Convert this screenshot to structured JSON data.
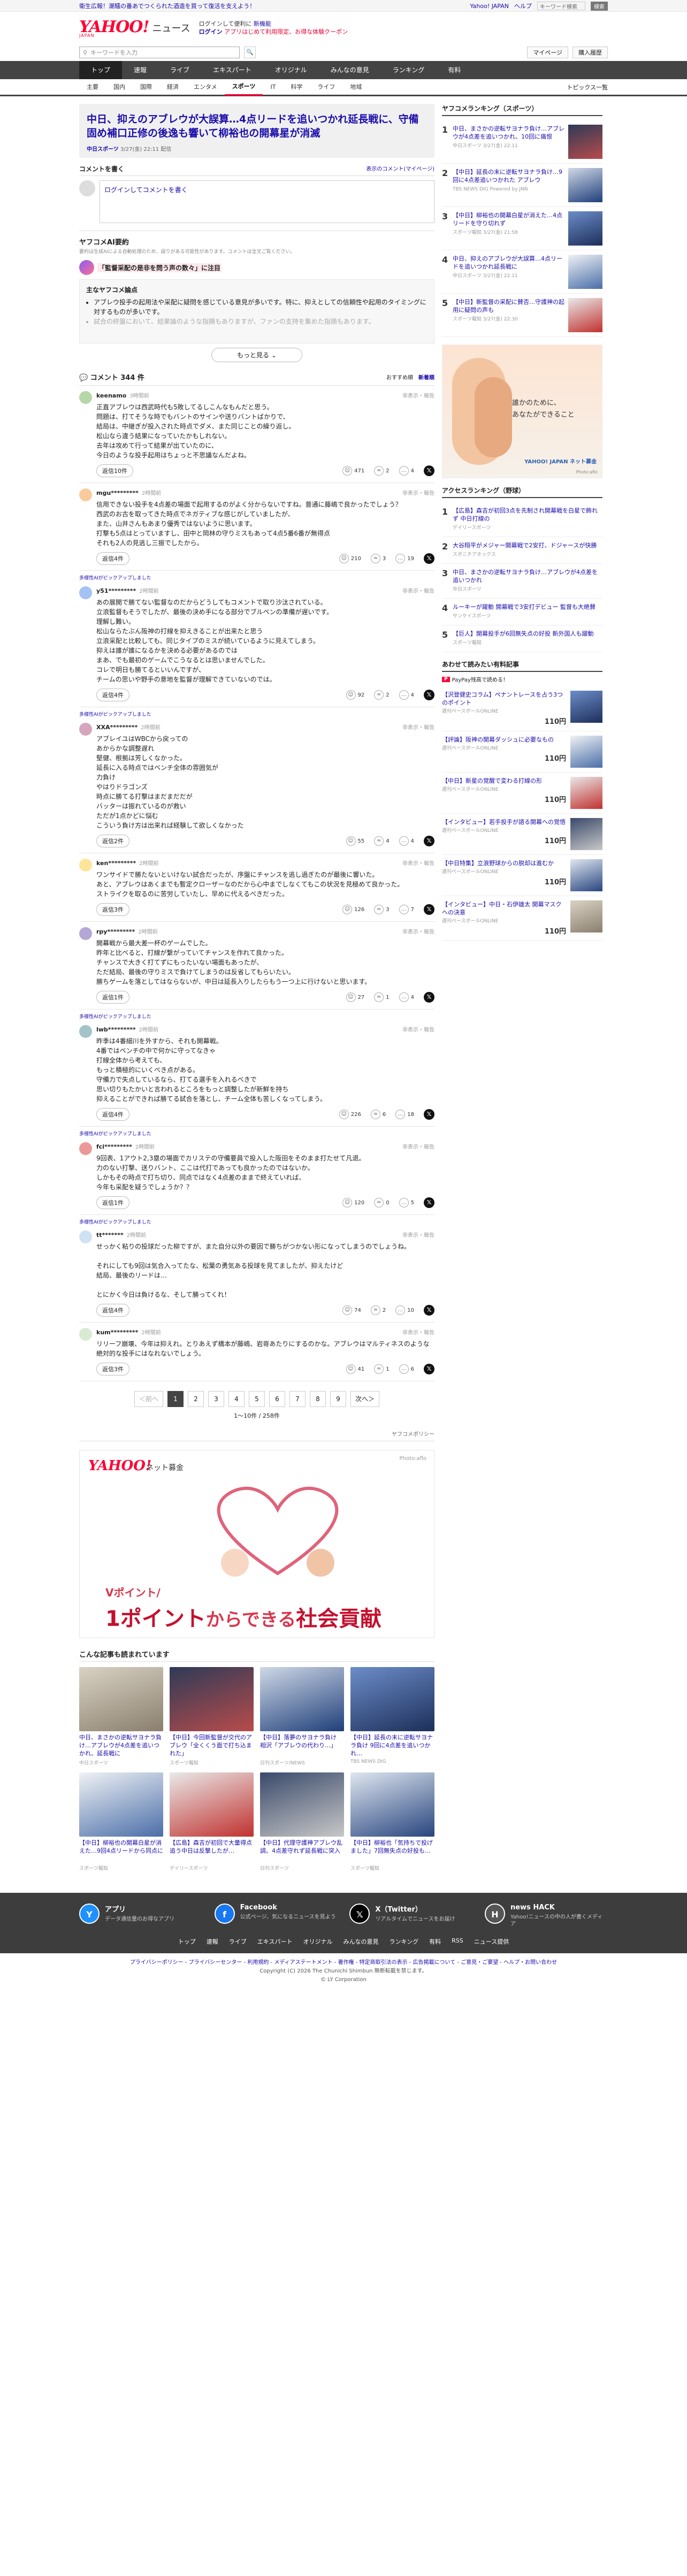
{
  "promo": {
    "text": "衛生広報！潮騒の番あでつくられた酒造を買って復活を支えよう！",
    "links": [
      "Yahoo! JAPAN",
      "ヘルプ"
    ],
    "search_placeholder": "キーワード検索",
    "search_button": "検索"
  },
  "header": {
    "logo": "YAHOO!",
    "logo_sub": "JAPAN",
    "logo_news": "ニュース",
    "line1": "ログインして便利に",
    "line1_link": "新機能",
    "login": "ログイン",
    "line2": "アプリはじめて利用限定、お得な体験クーポン"
  },
  "search": {
    "placeholder": "キーワードを入力",
    "my_page": "マイページ",
    "register": "購入履歴"
  },
  "nav": {
    "main": [
      "トップ",
      "速報",
      "ライブ",
      "エキスパート",
      "オリジナル",
      "みんなの意見",
      "ランキング",
      "有料"
    ],
    "sub": [
      "主要",
      "国内",
      "国際",
      "経済",
      "エンタメ",
      "スポーツ",
      "IT",
      "科学",
      "ライフ",
      "地域"
    ],
    "topics": "トピックス一覧"
  },
  "article": {
    "title": "中日、抑えのアブレウが大誤算…4点リードを追いつかれ延長戦に、守備固め補口正修の後逸も響いて柳裕也の開幕星が消滅",
    "source": "中日スポーツ",
    "date": "3/27(金) 22:11 配信"
  },
  "comment_input": {
    "heading": "コメントを書く",
    "policy_link": "表示のコメント(マイページ)",
    "placeholder": "ログインしてコメントを書く"
  },
  "ai": {
    "title": "ヤフコメAI要約",
    "note": "要約は生成AIによる自動処理のため、誤りがある可能性があります。コメントは全文ご覧ください。",
    "point_prefix": "「監督采配の是非を問う声の数々」に注目",
    "box_label": "主なヤフコメ論点",
    "bullets": [
      "アブレウ投手の起用法や采配に疑問を感じている意見が多いです。特に、抑えとしての信頼性や起用のタイミングに対するものが多いです。",
      "試合の終盤において、結果論のような指摘もありますが、ファンの支持を集めた指摘もあります。"
    ],
    "more": "もっと見る"
  },
  "comments_header": {
    "count": "コメント 344 件",
    "sort": [
      "おすすめ順",
      "新着順"
    ]
  },
  "comments": [
    {
      "user": "keenamo",
      "time": "3時間前",
      "report": "非表示・報告",
      "text": "正直アブレウは西武時代も5敗してるしこんなもんだと思う。\n問題は、打てそうな時でもバントのサインや送りバントばかりで、\n結局は、中継ぎが投入された時点でダメ、また同じことの繰り返し。\n松山なら違う結果になっていたかもしれない。\n去年は攻めて行って結果が出ていたのに、\n今日のような投手起用はちょっと不思議なんだよね。",
      "replies": "返信10件",
      "likes": "471",
      "ok": "2",
      "hmm": "4"
    },
    {
      "user": "mgu*********",
      "time": "2時間前",
      "report": "非表示・報告",
      "text": "信用できない投手を4点差の場面で起用するのがよく分からないですね。普通に藤嶋で良かったでしょう？\n西武のお古を取ってきた時点でネガティブな感じがしていましたが、\nまた、山井さんもあまり優秀ではないように思います。\n打撃も5点はとっていますし、田中と岡林の守りミスもあって4点5番6番が無得点\nそれも2人の見逃し三振でしたから。",
      "replies": "返信4件",
      "likes": "210",
      "ok": "3",
      "hmm": "19"
    },
    {
      "user": "y51*********",
      "time": "2時間前",
      "report": "非表示・報告",
      "text": "あの展開で勝てない監督なのだからどうしてもコメントで取り沙汰されている。\n立浪監督もそうでしたが、最後の決め手になる部分でブルペンの準備が遅いです。\n理解し難い。\n松山ならたぶん阪神の打線を抑えきることが出来たと思う\n立浪采配と比較しても、同じタイプのミスが続いているように見えてしまう。\n抑えは誰が誰になるかを決める必要があるのでは\nまあ、でも最初のゲームでこうなるとは思いませんでした。\nコレで明日も勝てるといいんですが、\nチームの思いや野手の意地を監督が理解できていないのでは。",
      "replies": "返信4件",
      "likes": "92",
      "ok": "2",
      "hmm": "4"
    },
    {
      "user": "XXA*********",
      "time": "2時間前",
      "report": "非表示・報告",
      "text": "アブレイユはWBCから戻っての\nあからかな調整遅れ\n堅健、根拠は芳しくなかった。\n延長に入る時点ではベンチ全体の雰囲気が\n力負け\nやはりドラゴンズ\n時点に勝てる打撃はまだまだだが\nバッターは振れているのが救い\nただが1点かどに悩む\nこういう負け方は出来れば経験して欲しくなかった",
      "replies": "返信2件",
      "likes": "55",
      "ok": "4",
      "hmm": "4"
    },
    {
      "user": "ken*********",
      "time": "2時間前",
      "report": "非表示・報告",
      "text": "ワンサイドで勝たないといけない試合だったが、序盤にチャンスを逃し過ぎたのが最後に響いた。\nあと、アブレウはあくまでも暫定クローザーなのだから心中までしなくてもこの状況を見極めて良かった。\nストライクを取るのに苦労していたし、早めに代えるべきだった。",
      "replies": "返信3件",
      "likes": "126",
      "ok": "3",
      "hmm": "7"
    },
    {
      "user": "rpy*********",
      "time": "2時間前",
      "report": "非表示・報告",
      "text": "開幕戦から最大差一杯のゲームでした。\n昨年と比べると、打線が繋がっていてチャンスを作れて良かった。\nチャンスで大きく打てずにもったいない場面もあったが、\nただ結局、最後の守りミスで負けてしまうのは反省してもらいたい。\n勝ちゲームを落としてはならないが、中日は延長入りしたらもう一つ上に行けないと思います。",
      "replies": "返信1件",
      "likes": "27",
      "ok": "1",
      "hmm": "4"
    },
    {
      "user": "lwb*********",
      "time": "2時間前",
      "report": "非表示・報告",
      "text": "昨季は4番細川を外すから、それも開幕戦。\n4番ではベンチの中で何かに守ってなきゃ\n打線全体から考えても、\nもっと積極的にいくべき点がある。\n守備力で失点しているなら、打てる選手を入れるべきで\n思い切りもたかいと言われるところをもっと調整したが新鮮を持ち\n抑えることができれば勝てる試合を落とし、チーム全体も苦しくなってしまう。",
      "replies": "返信4件",
      "likes": "226",
      "ok": "6",
      "hmm": "18"
    },
    {
      "user": "fci*********",
      "time": "2時間前",
      "report": "非表示・報告",
      "text": "9回表、1アウト2,3塁の場面でカリステの守備要員で投入した阪田をそのまま打たせて凡退。\n力のない打撃、送りバント、ここは代打であっても良かったのではないか。\nしかもその時点で打ち切り、同点ではなく4点差のままで終えていれば、\n今年も采配を疑うでしょうか？？",
      "replies": "返信1件",
      "likes": "120",
      "ok": "0",
      "hmm": "5"
    },
    {
      "user": "tt*******",
      "time": "2時間前",
      "report": "非表示・報告",
      "text": "せっかく粘りの投球だった柳ですが、また自分以外の要因で勝ちがつかない形になってしまうのでしょうね。\n\nそれにしても9回は気合入ってたな、松葉の勇気ある投球を見てましたが、抑えたけど\n結局、最後のリードは…\n\nとにかく今日は負けるな、そして勝ってくれ！",
      "replies": "返信4件",
      "likes": "74",
      "ok": "2",
      "hmm": "10"
    },
    {
      "user": "kum*********",
      "time": "2時間前",
      "report": "非表示・報告",
      "text": "リリーフ崩壊、今年は抑えれ。とりあえず橋本が藤嶋、岩嵜あたりにするのかな。アブレウはマルティネスのような\n絶対的な投手にはなれないでしょう。",
      "replies": "返信3件",
      "likes": "41",
      "ok": "1",
      "hmm": "6"
    }
  ],
  "ad_labels": [
    "多様性AIがピックアップしました"
  ],
  "pager": {
    "prev": "＜前へ",
    "pages": [
      "1",
      "2",
      "3",
      "4",
      "5",
      "6",
      "7",
      "8",
      "9"
    ],
    "next": "次へ＞",
    "count": "1〜10件 / 258件",
    "policy": "ヤフコメポリシー"
  },
  "bigad": {
    "logo": "YAHOO!",
    "fund": "ネット募金",
    "photo": "Photo:aflo",
    "v1": "Vポイント/",
    "v2_a": "1ポイント",
    "v2_b": "からできる",
    "v2_c": "社会貢献"
  },
  "recommend": {
    "title": "こんな記事も読まれています",
    "items": [
      {
        "text": "中日、まさかの逆転サヨナラ負け…アブレウが4点差を追いつかれ、延長戦に",
        "src": "中日スポーツ"
      },
      {
        "text": "【中日】今回新監督が交代のアブレウ「全くくう面で打ち込まれた」",
        "src": "スポーツ報知"
      },
      {
        "text": "【中日】落夢のサヨナラ負け 相沢「アブレウの代わり…」",
        "src": "日刊スポーツ/NEWS"
      },
      {
        "text": "【中日】延長の末に逆転サヨナラ負け 9回に4点差を追いつかれ…",
        "src": "TBS NEWS DIG"
      },
      {
        "text": "【中日】柳裕也の開幕白星が消えた…9回4点リードから同点に",
        "src": "スポーツ報知"
      },
      {
        "text": "【広島】森吉が初回で大量得点 追う中日は反撃したが…",
        "src": "デイリースポーツ"
      },
      {
        "text": "【中日】代理守護神アブレウ乱調、4点差守れず延長戦に突入",
        "src": "日刊スポーツ"
      },
      {
        "text": "【中日】柳裕也「気持ちで投げました」7回無失点の好投も…",
        "src": "スポーツ報知"
      }
    ]
  },
  "side": {
    "ranking_title": "ヤフコメランキング（スポーツ）",
    "ranking": [
      {
        "text": "中日、まさかの逆転サヨナラ負け…アブレウが4点差を追いつかれ、10回に痛恨",
        "src": "中日スポーツ 3/27(金) 22:11"
      },
      {
        "text": "【中日】延長の末に逆転サヨナラ負け…9回に4点差追いつかれた アブレウ",
        "src": "TBS NEWS DIG Powered by JNN"
      },
      {
        "text": "【中日】柳裕也の開幕白星が消えた…4点リードを守り切れず",
        "src": "スポーツ報知 3/27(金) 21:58"
      },
      {
        "text": "中日、抑えのアブレウが大誤算…4点リードを追いつかれ延長戦に",
        "src": "中日スポーツ 3/27(金) 22:11"
      },
      {
        "text": "【中日】新監督の采配に賛否…守護神の起用に疑問の声も",
        "src": "スポーツ報知 3/27(金) 22:30"
      }
    ],
    "ad": {
      "text1": "誰かのために、",
      "text2": "あなたができること",
      "brand": "YAHOO! JAPAN ネット募金",
      "credit": "Photo:aflo"
    },
    "access_title": "アクセスランキング（野球）",
    "access": [
      {
        "text": "【広島】森吉が初回3点を先制され開幕戦を白星で飾れず 中日打線の",
        "src": "デイリースポーツ"
      },
      {
        "text": "大谷翔平がメジャー開幕戦で2安打、ドジャースが快勝",
        "src": "スポニチアネックス"
      },
      {
        "text": "中日、まさかの逆転サヨナラ負け…アブレウが4点差を追いつかれ",
        "src": "中日スポーツ"
      },
      {
        "text": "ルーキーが躍動 開幕戦で3安打デビュー 監督も大絶賛",
        "src": "サンケイスポーツ"
      },
      {
        "text": "【巨人】開幕投手が6回無失点の好投 新外国人も躍動",
        "src": "スポーツ報知"
      }
    ],
    "paid_title": "あわせて読みたい有料記事",
    "paid_sub": "PayPay残高で読める！",
    "paid": [
      {
        "text": "【沢登健史コラム】ペナントレースを占う3つのポイント",
        "src": "週刊ベースボールONLINE",
        "price": "110円"
      },
      {
        "text": "【評論】阪神の開幕ダッシュに必要なもの",
        "src": "週刊ベースボールONLINE",
        "price": "110円"
      },
      {
        "text": "【中日】新星の覚醒で変わる打線の形",
        "src": "週刊ベースボールONLINE",
        "price": "110円"
      },
      {
        "text": "【インタビュー】若手投手が語る開幕への覚悟",
        "src": "週刊ベースボールONLINE",
        "price": "110円"
      },
      {
        "text": "【中日特集】立浪野球からの脱却は進むか",
        "src": "週刊ベースボールONLINE",
        "price": "110円"
      },
      {
        "text": "【インタビュー】中日・石伊雄太 開幕マスクへの決意",
        "src": "週刊ベースボールONLINE",
        "price": "110円"
      }
    ]
  },
  "footer": {
    "cols": [
      {
        "title": "アプリ",
        "desc": "データ通信量のお得なアプリ"
      },
      {
        "title": "Facebook",
        "desc": "公式ページ、気になるニュースを見よう"
      },
      {
        "title": "X（Twitter）",
        "desc": "リアルタイムでニュースをお届け"
      },
      {
        "title": "news HACK",
        "desc": "Yahoo!ニュースの中の人が書くメディア"
      }
    ],
    "links": [
      "トップ",
      "速報",
      "ライブ",
      "エキスパート",
      "オリジナル",
      "みんなの意見",
      "ランキング",
      "有料",
      "RSS",
      "ニュース提供"
    ],
    "bottom1": "プライバシーポリシー - プライバシーセンター - 利用規約 - メディアステートメント - 著作権 - 特定商取引法の表示 - 広告掲載について - ご意見・ご要望 - ヘルプ・お問い合わせ",
    "bottom2": "Copyright (C) 2026 The Chunichi Shimbun 無断転載を禁じます。",
    "bottom3": "© LY Corporation"
  }
}
